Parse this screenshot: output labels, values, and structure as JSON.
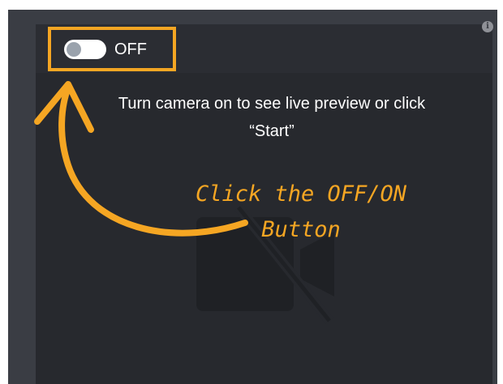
{
  "toggle": {
    "state_label": "OFF",
    "is_on": false
  },
  "preview": {
    "instruction_line1": "Turn camera on to see live preview or click",
    "instruction_line2": "“Start”",
    "camera_icon": "camera-off-icon"
  },
  "info": {
    "icon": "info-icon",
    "glyph": "i"
  },
  "annotation": {
    "callout_line1": "Click the OFF/ON",
    "callout_line2": "Button",
    "arrow_icon": "curved-arrow-icon"
  },
  "colors": {
    "accent": "#f5a623",
    "panel": "#3a3d44",
    "preview_bg": "#27292e",
    "text": "#ffffff",
    "knob": "#9aa2ac"
  }
}
